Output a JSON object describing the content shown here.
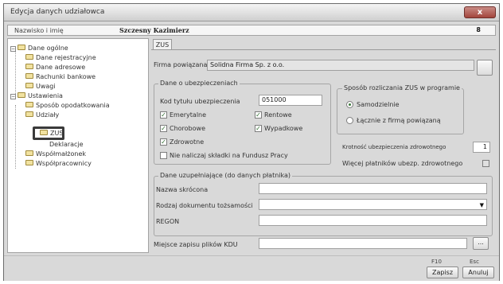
{
  "window": {
    "title": "Edycja danych udziałowca",
    "close_glyph": "x"
  },
  "namebar": {
    "label": "Nazwisko i imię",
    "value": "Szczesny Kazimierz",
    "right_glyph": "8"
  },
  "tree": {
    "items": [
      {
        "label": "Dane ogólne"
      },
      {
        "label": "Dane rejestracyjne"
      },
      {
        "label": "Dane adresowe"
      },
      {
        "label": "Rachunki bankowe"
      },
      {
        "label": "Uwagi"
      },
      {
        "label": "Ustawienia"
      },
      {
        "label": "Sposób opodatkowania"
      },
      {
        "label": "Udziały"
      },
      {
        "label": "ZUS"
      },
      {
        "label": "Deklaracje"
      },
      {
        "label": "Współmałżonek"
      },
      {
        "label": "Współpracownicy"
      }
    ]
  },
  "tab": {
    "label": "ZUS"
  },
  "firma": {
    "label": "Firma powiązana",
    "value": "Solidna Firma Sp. z o.o."
  },
  "dane_ubezp": {
    "title": "Dane o ubezpieczeniach",
    "kod_label": "Kod tytułu ubezpieczenia",
    "kod_value": "051000",
    "emerytalne": "Emerytalne",
    "rentowe": "Rentowe",
    "chorobowe": "Chorobowe",
    "wypadkowe": "Wypadkowe",
    "zdrowotne": "Zdrowotne",
    "nie_naliczaj": "Nie naliczaj składki na Fundusz Pracy",
    "check": "✓"
  },
  "sposob": {
    "title": "Sposób rozliczania ZUS w programie",
    "opt1": "Samodzielnie",
    "opt2": "Łącznie z firmą powiązaną"
  },
  "krotnosc": {
    "label": "Krotność ubezpieczenia zdrowotnego",
    "value": "1"
  },
  "wiecej": {
    "label": "Więcej płatników ubezp. zdrowotnego"
  },
  "dane_uzup": {
    "title": "Dane uzupełniające (do danych płatnika)",
    "nazwa_label": "Nazwa skrócona",
    "rodzaj_label": "Rodzaj dokumentu tożsamości",
    "regon_label": "REGON"
  },
  "miejsce": {
    "label": "Miejsce zapisu plików KDU",
    "browse": "..."
  },
  "footer": {
    "f10": "F10",
    "esc": "Esc",
    "zapisz": "Zapisz",
    "anuluj": "Anuluj"
  }
}
